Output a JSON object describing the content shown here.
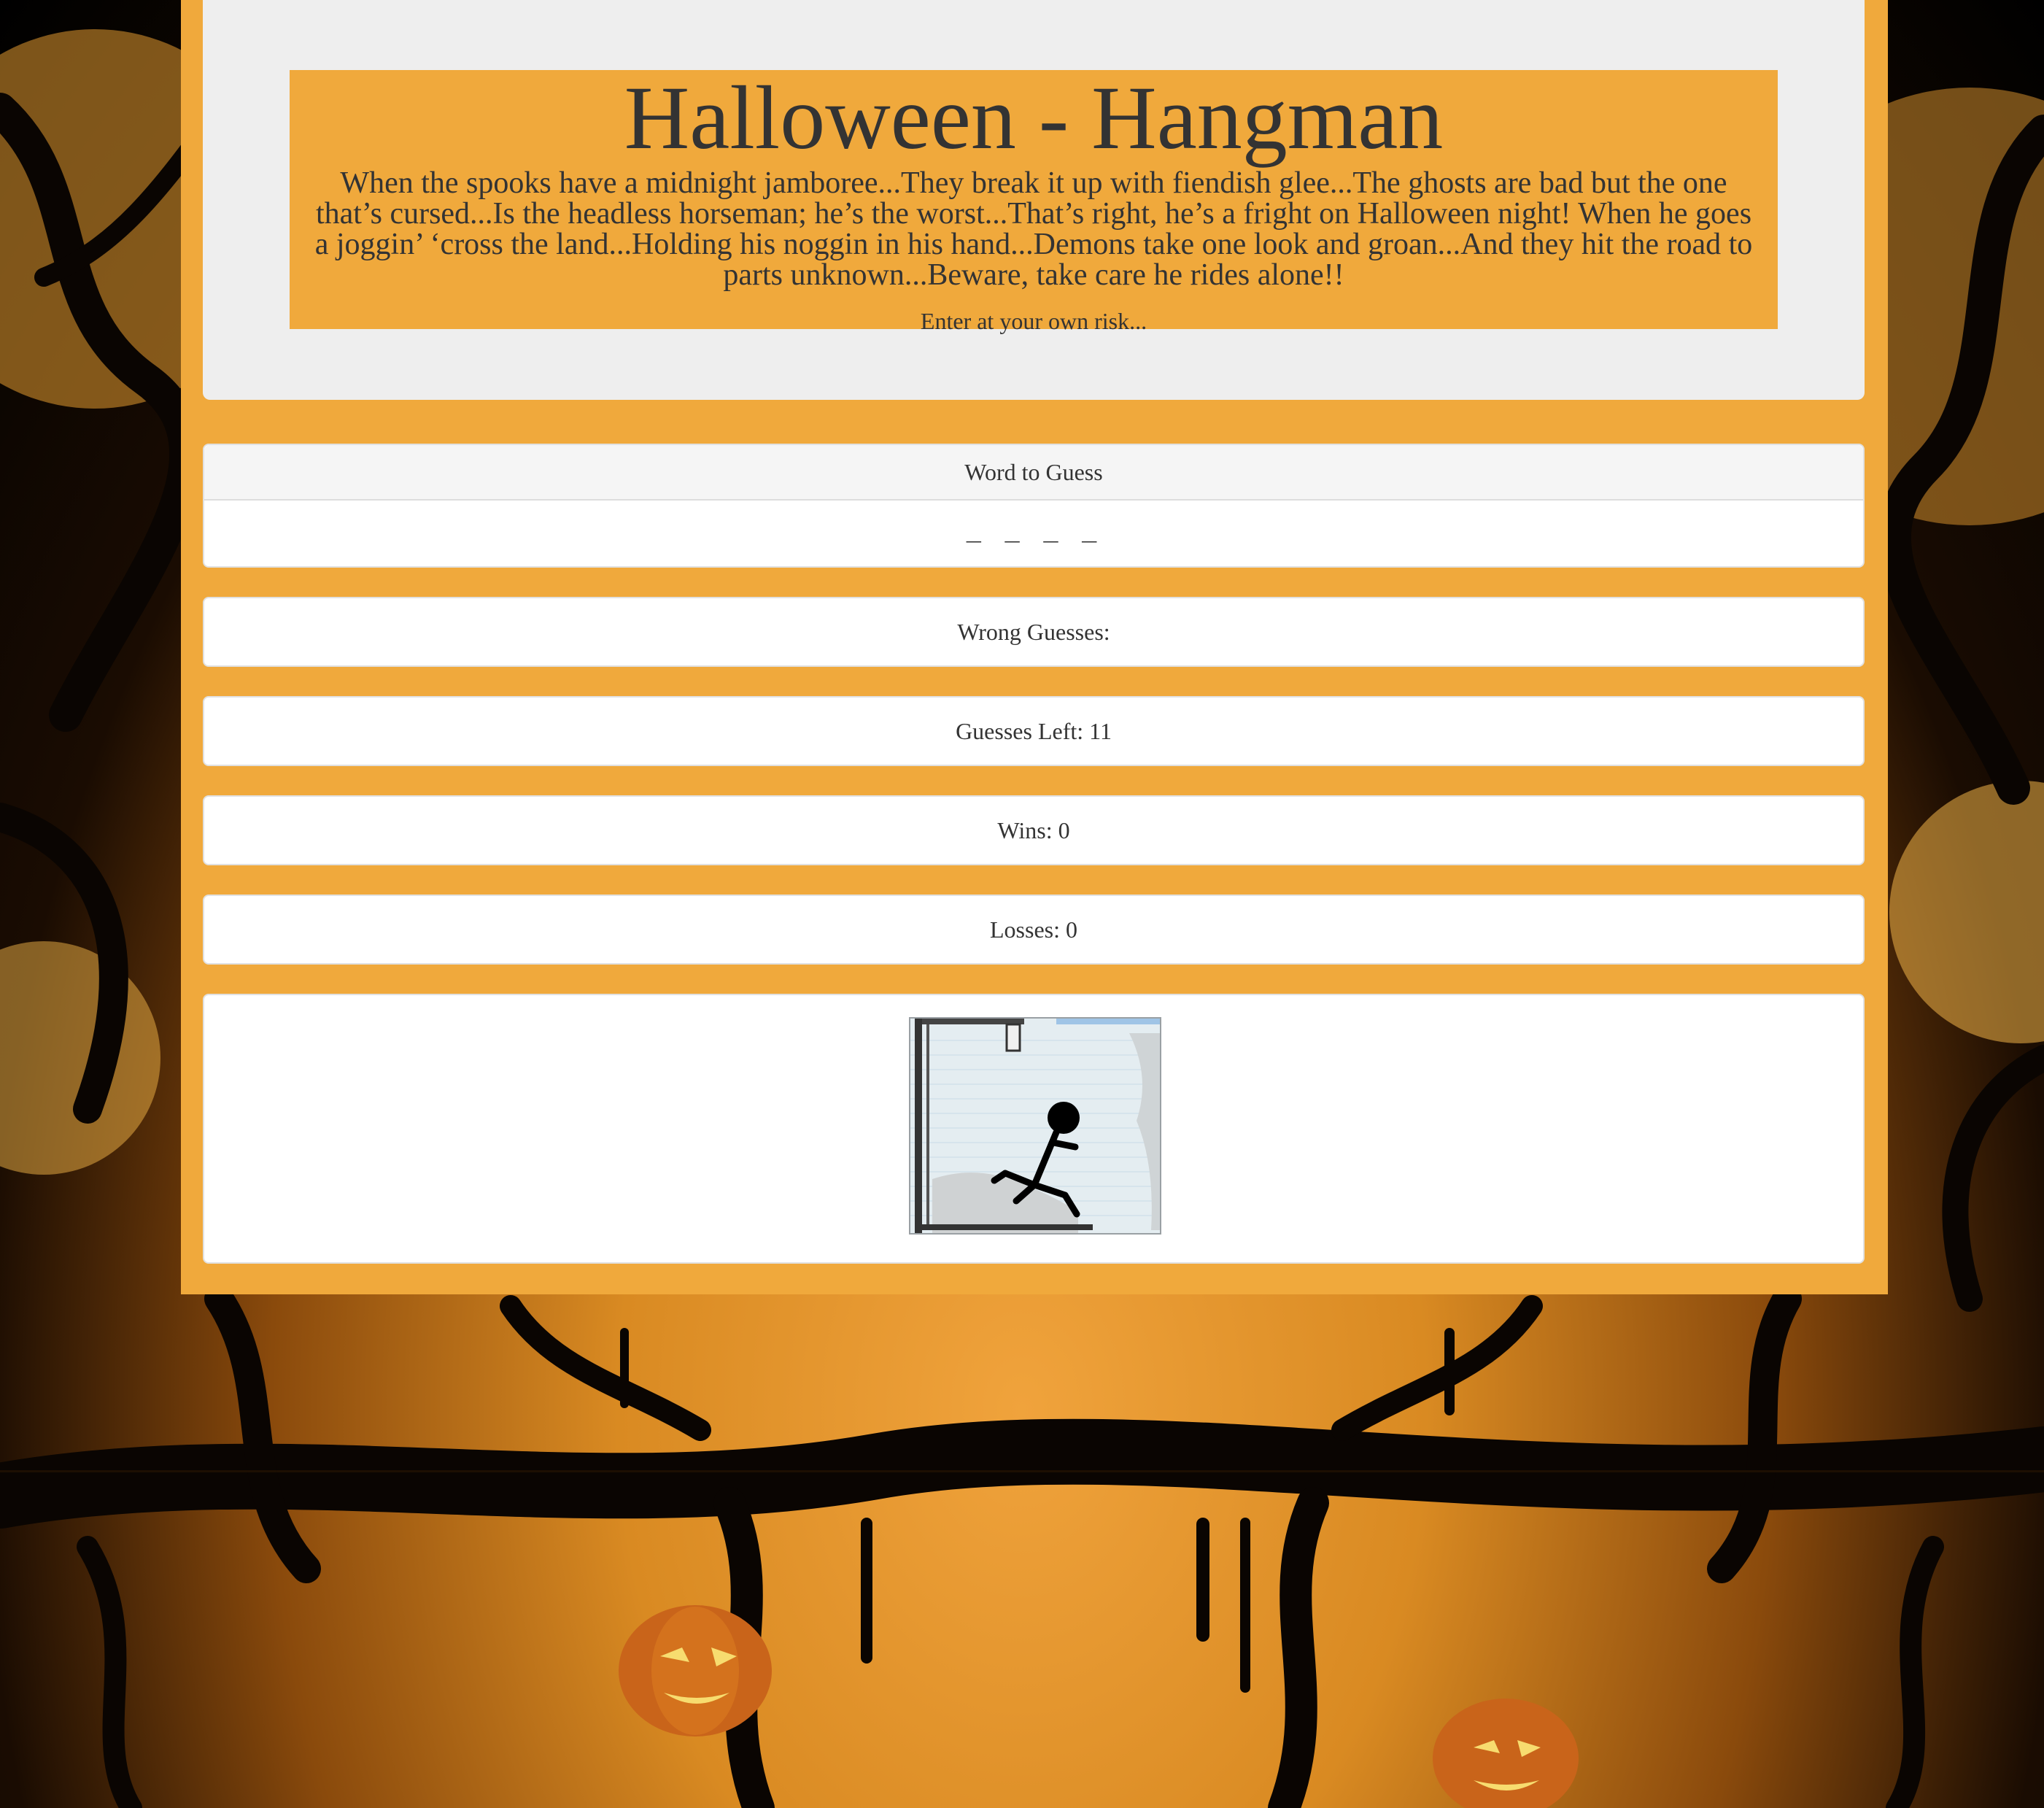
{
  "header": {
    "title": "Halloween - Hangman",
    "poem": "When the spooks have a midnight jamboree...They break it up with fiendish glee...The ghosts are bad but the one that’s cursed...Is the headless horseman; he’s the worst...That’s right, he’s a fright on Halloween night! When he goes a joggin’ ‘cross the land...Holding his noggin in his hand...Demons take one look and groan...And they hit the road to parts unknown...Beware, take care he rides alone!!",
    "tagline": "Enter at your own risk..."
  },
  "game": {
    "word_heading": "Word to Guess",
    "word_display": "_ _ _ _",
    "wrong_guesses": "Wrong Guesses:",
    "guesses_left": "Guesses Left: 11",
    "wins": "Wins: 0",
    "losses": "Losses: 0"
  },
  "images": {
    "hangman": "hangman-stickfigure-image"
  },
  "colors": {
    "panel_orange": "#f0a93c",
    "jumbotron_gray": "#eeeeee",
    "text": "#333333",
    "background_dark": "#000000"
  }
}
